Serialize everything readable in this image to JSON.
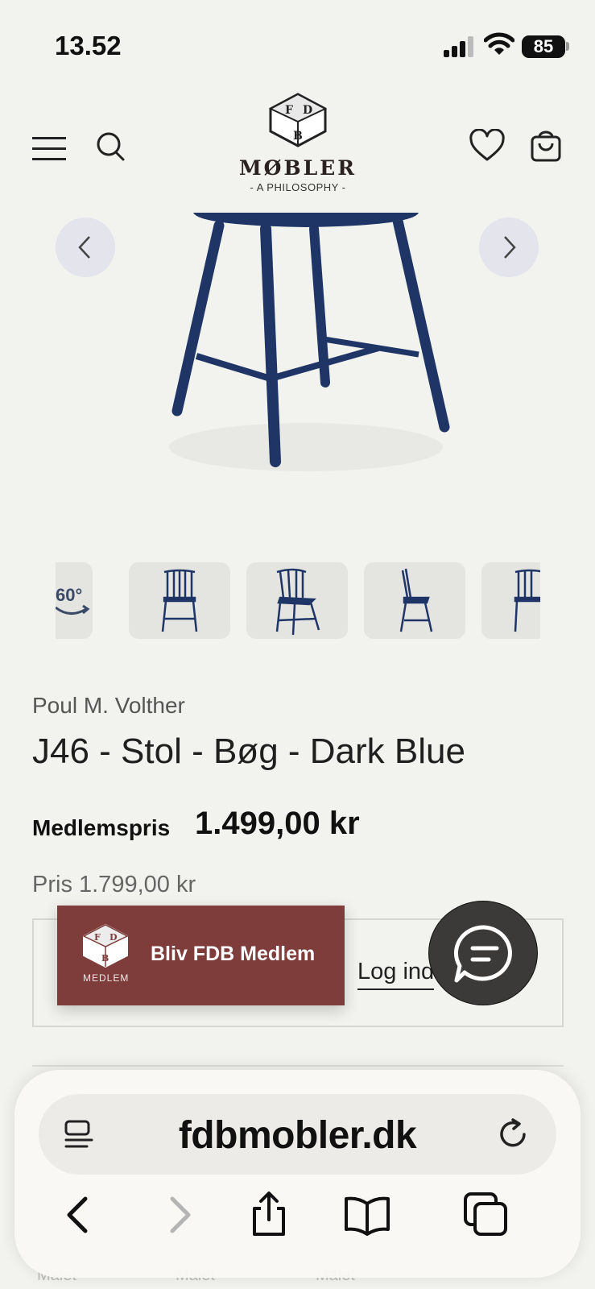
{
  "status_bar": {
    "time": "13.52",
    "battery": "85"
  },
  "header": {
    "logo_wordmark": "MØBLER",
    "logo_tagline": "- A PHILOSOPHY -"
  },
  "thumbnails": {
    "first_label": "60°"
  },
  "product": {
    "designer": "Poul M. Volther",
    "title": "J46 - Stol - Bøg - Dark Blue",
    "member_price_label": "Medlemspris",
    "member_price": "1.499,00 kr",
    "regular_price": "Pris 1.799,00 kr",
    "login_link": "Log ind"
  },
  "member_banner": {
    "logo_caption": "MEDLEM",
    "label": "Bliv FDB Medlem"
  },
  "faded_labels": [
    "Malet",
    "Malet",
    "Malet"
  ],
  "safari": {
    "url": "fdbmobler.dk"
  },
  "colors": {
    "background": "#f2f2ee",
    "banner": "#7e3c3b",
    "chair": "#1e3566",
    "chat": "#3b3a38"
  }
}
